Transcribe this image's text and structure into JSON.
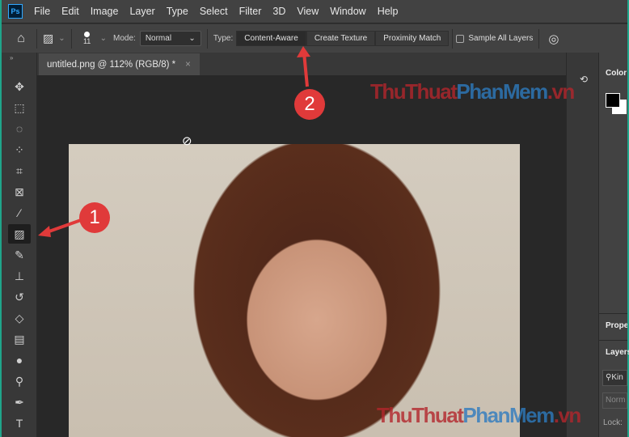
{
  "app": {
    "logo": "Ps"
  },
  "menu": [
    "File",
    "Edit",
    "Image",
    "Layer",
    "Type",
    "Select",
    "Filter",
    "3D",
    "View",
    "Window",
    "Help"
  ],
  "options": {
    "brush_size": "11",
    "mode_label": "Mode:",
    "mode_value": "Normal",
    "type_label": "Type:",
    "types": [
      "Content-Aware",
      "Create Texture",
      "Proximity Match"
    ],
    "active_type": "Content-Aware",
    "sample_all_layers": "Sample All Layers",
    "sample_checked": false
  },
  "document": {
    "tab_title": "untitled.png @ 112% (RGB/8) *",
    "close": "×"
  },
  "panels": {
    "color": "Color",
    "properties": "Prope",
    "layers": "Layers",
    "search_kind": "Kin",
    "blend": "Norm",
    "lock": "Lock:"
  },
  "annotations": {
    "step1": "1",
    "step2": "2"
  },
  "watermark": {
    "part1": "ThuThuat",
    "part2": "PhanMem",
    "part3": ".vn"
  },
  "colors": {
    "accent_red": "#e03a3a",
    "bg": "#282828"
  }
}
